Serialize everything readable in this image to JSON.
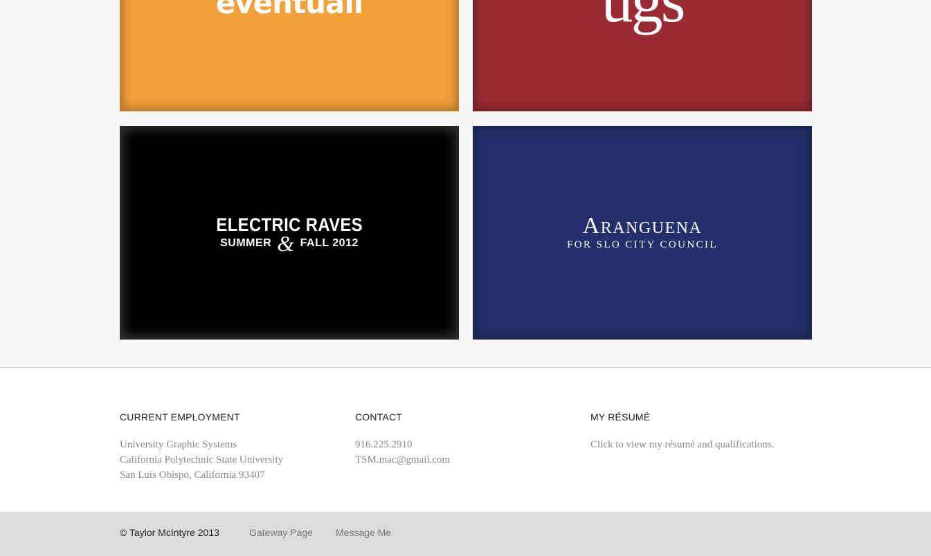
{
  "portfolio": {
    "tiles": [
      {
        "logo": "eventuall",
        "bg": "#f2a03a"
      },
      {
        "logo": "ugs",
        "bg": "#992b33"
      },
      {
        "line1": "ELECTRIC RAVES",
        "line2a": "SUMMER",
        "amp": "&",
        "line2b": "FALL 2012",
        "bg": "#000000"
      },
      {
        "line1": "Aranguena",
        "line2": "FOR SLO CITY COUNCIL",
        "bg": "#24306b"
      }
    ]
  },
  "info": {
    "employment": {
      "heading": "CURRENT EMPLOYMENT",
      "lines": [
        "University Graphic Systems",
        "California Polytechnic State University",
        "San Luis Obispo, California 93407"
      ]
    },
    "contact": {
      "heading": "CONTACT",
      "phone": "916.225.2910",
      "email": "TSM.mac@gmail.com"
    },
    "resume": {
      "heading": "MY RÉSUMÉ",
      "text": "Click to view my résumé and qualifications."
    }
  },
  "footer": {
    "copyright": "© Taylor McIntyre 2013",
    "links": [
      "Gateway Page",
      "Message Me"
    ]
  }
}
